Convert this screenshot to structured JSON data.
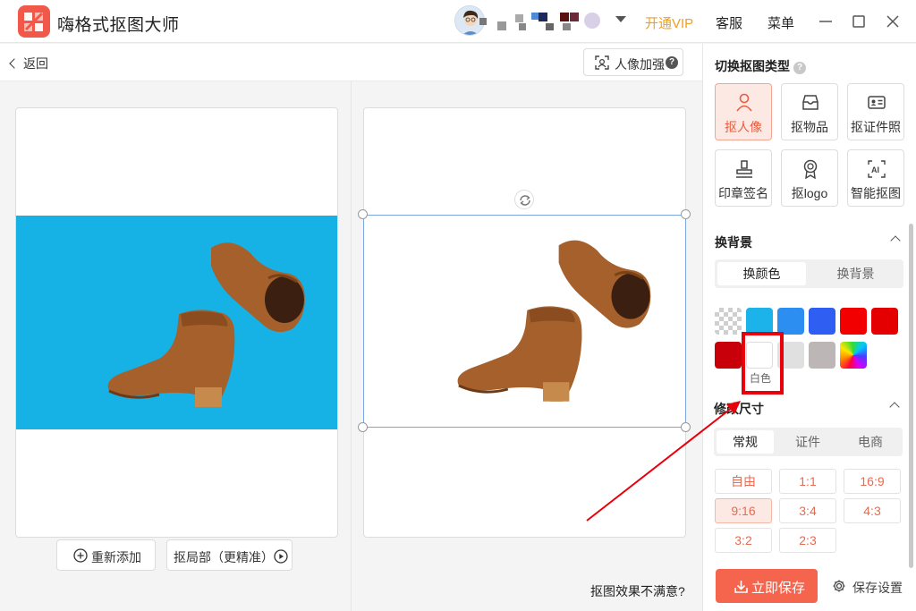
{
  "app": {
    "title": "嗨格式抠图大师"
  },
  "header": {
    "vip": "开通VIP",
    "service": "客服",
    "menu": "菜单"
  },
  "toolbar": {
    "back": "返回",
    "enhance": "人像加强",
    "enhance_help": "?"
  },
  "left_panel": {
    "add_again": "重新添加",
    "local_cut": "抠局部（更精准）"
  },
  "footer": {
    "unsatisfied": "抠图效果不满意?"
  },
  "right_panel": {
    "cut_type_title": "切换抠图类型",
    "cut_types": [
      {
        "label": "抠人像",
        "icon": "person-icon",
        "active": true
      },
      {
        "label": "抠物品",
        "icon": "tray-icon",
        "active": false
      },
      {
        "label": "抠证件照",
        "icon": "id-card-icon",
        "active": false
      },
      {
        "label": "印章签名",
        "icon": "stamp-icon",
        "active": false
      },
      {
        "label": "抠logo",
        "icon": "award-icon",
        "active": false
      },
      {
        "label": "智能抠图",
        "icon": "ai-icon",
        "active": false
      }
    ],
    "bg_title": "换背景",
    "bg_tabs": [
      "换颜色",
      "换背景"
    ],
    "bg_tab_selected": 0,
    "colors": [
      "transparent",
      "#1bb3ea",
      "#2b8ef0",
      "#2f5ef2",
      "#f20000",
      "#e40000",
      "#c8000a",
      "#ffffff",
      "#e0e0e0",
      "#bdb6b6",
      "rainbow"
    ],
    "selected_color_label": "白色",
    "size_title": "修改尺寸",
    "size_tabs": [
      "常规",
      "证件",
      "电商"
    ],
    "size_tab_selected": 0,
    "ratios": [
      "自由",
      "1:1",
      "16:9",
      "9:16",
      "3:4",
      "4:3",
      "3:2",
      "2:3"
    ],
    "ratio_selected": "9:16",
    "save_now": "立即保存",
    "save_settings": "保存设置"
  }
}
